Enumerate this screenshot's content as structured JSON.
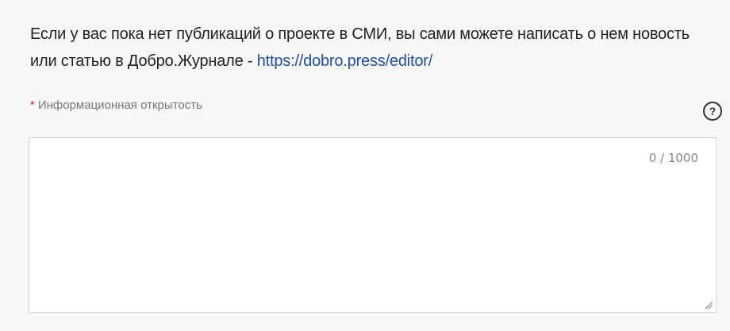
{
  "info": {
    "text": "Если у вас пока нет публикаций о проекте в СМИ, вы сами можете написать о нем новость или статью в Добро.Журнале - ",
    "link": "https://dobro.press/editor/"
  },
  "field": {
    "required_mark": "*",
    "label": "Информационная открытость",
    "help_glyph": "?",
    "counter": "0 / 1000",
    "value": ""
  },
  "colors": {
    "link": "#1f4fa8",
    "required": "#d62828",
    "border": "#d3d3d3",
    "background": "#f7f7f7"
  },
  "icons": {
    "help": "help-circle-icon",
    "resize": "resize-handle-icon"
  }
}
